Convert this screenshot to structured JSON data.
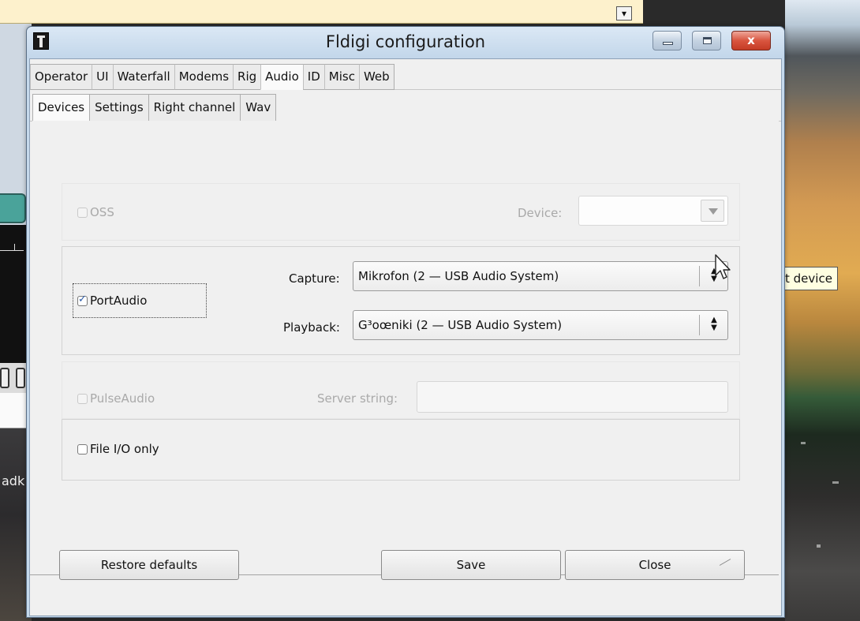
{
  "window": {
    "title": "Fldigi configuration",
    "close_glyph": "x"
  },
  "tabs_main": [
    {
      "label": "Operator",
      "active": false
    },
    {
      "label": "UI",
      "active": false
    },
    {
      "label": "Waterfall",
      "active": false
    },
    {
      "label": "Modems",
      "active": false
    },
    {
      "label": "Rig",
      "active": false
    },
    {
      "label": "Audio",
      "active": true
    },
    {
      "label": "ID",
      "active": false
    },
    {
      "label": "Misc",
      "active": false
    },
    {
      "label": "Web",
      "active": false
    }
  ],
  "tabs_sub": [
    {
      "label": "Devices",
      "active": true
    },
    {
      "label": "Settings",
      "active": false
    },
    {
      "label": "Right channel",
      "active": false
    },
    {
      "label": "Wav",
      "active": false
    }
  ],
  "oss": {
    "label": "OSS",
    "checked": false,
    "enabled": false,
    "device_label": "Device:",
    "device_value": ""
  },
  "portaudio": {
    "label": "PortAudio",
    "checked": true,
    "capture_label": "Capture:",
    "capture_value": "Mikrofon (2 — USB Audio System)",
    "playback_label": "Playback:",
    "playback_value": "G³oœniki (2 — USB Audio System)"
  },
  "pulseaudio": {
    "label": "PulseAudio",
    "checked": false,
    "enabled": false,
    "server_label": "Server string:",
    "server_value": ""
  },
  "file_io": {
    "label": "File I/O only",
    "checked": false
  },
  "buttons": {
    "restore": "Restore defaults",
    "save": "Save",
    "close": "Close"
  },
  "background": {
    "tooltip_text": "t device",
    "left_text": "adk",
    "arrow_glyph": "▾"
  },
  "colors": {
    "titlebar": "#c2d6ea",
    "close_button": "#d9553f",
    "tooltip_bg": "#ffffe1",
    "check_mark": "#2a5aa8"
  }
}
